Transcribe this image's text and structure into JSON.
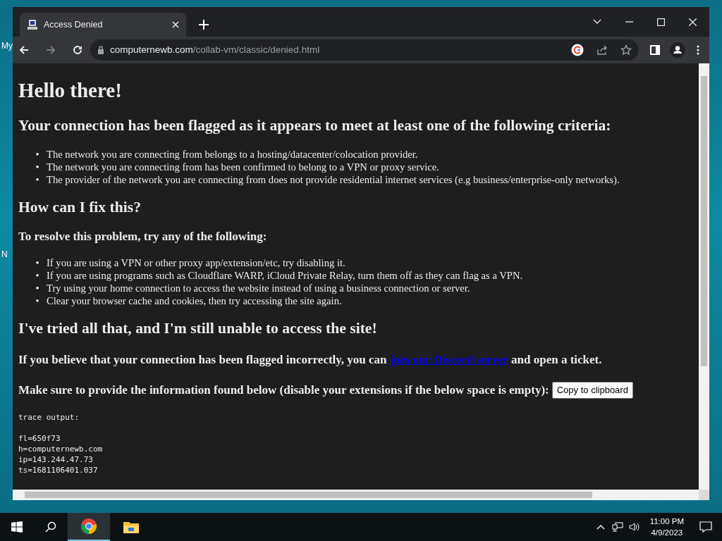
{
  "desktop": {
    "icon_labels": [
      "My",
      "N"
    ]
  },
  "browser": {
    "tabs": [
      {
        "title": "Access Denied",
        "selected": true
      }
    ],
    "url": {
      "domain": "computernewb.com",
      "path": "/collab-vm/classic/denied.html"
    }
  },
  "page": {
    "blocks": [
      {
        "kind": "h1",
        "text": "Hello there!"
      },
      {
        "kind": "h2",
        "text": "Your connection has been flagged as it appears to meet at least one of the following criteria:"
      },
      {
        "kind": "list",
        "marker": "•",
        "items": [
          "The network you are connecting from belongs to a hosting/datacenter/colocation provider.",
          "The network you are connecting from has been confirmed to belong to a VPN or proxy service.",
          "The provider of the network you are connecting from does not provide residential internet services (e.g business/enterprise-only networks)."
        ]
      },
      {
        "kind": "h2",
        "text": "How can I fix this?"
      },
      {
        "kind": "h3",
        "text": "To resolve this problem, try any of the following:"
      },
      {
        "kind": "list",
        "marker": "•",
        "items": [
          "If you are using a VPN or other proxy app/extension/etc, try disabling it.",
          "If you are using programs such as Cloudflare WARP, iCloud Private Relay, turn them off as they can flag as a VPN.",
          "Try using your home connection to access the website instead of using a business connection or server.",
          "Clear your browser cache and cookies, then try accessing the site again."
        ]
      },
      {
        "kind": "h2",
        "text": "I've tried all that, and I'm still unable to access the site!"
      },
      {
        "kind": "link_para",
        "before": "If you believe that your connection has been flagged incorrectly, you can",
        "link": "join our Discord server",
        "after": "and open a ticket."
      },
      {
        "kind": "button_para",
        "text": "Make sure to provide the information found below (disable your extensions if the below space is empty):",
        "button": "Copy to clipboard"
      },
      {
        "kind": "pre",
        "header": "trace output:",
        "lines": [
          "fl=650f73",
          "h=computernewb.com",
          "ip=143.244.47.73",
          "ts=1681106401.037"
        ]
      }
    ]
  },
  "taskbar": {
    "apps": [
      {
        "kind": "chrome",
        "selected": true
      },
      {
        "kind": "explorer",
        "selected": false
      }
    ],
    "time": "11:00 PM",
    "date": "4/9/2023"
  }
}
